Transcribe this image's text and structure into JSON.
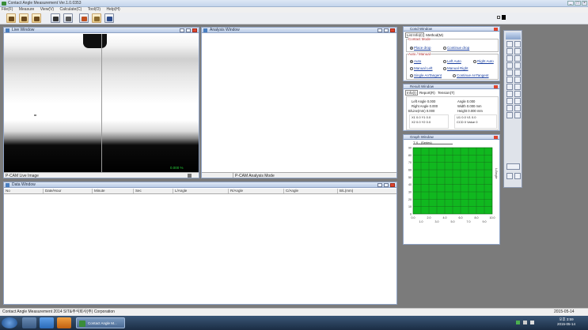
{
  "window": {
    "title": "Contact Angle Measurement Ver.1.0.0353"
  },
  "menu": [
    "File(F)",
    "Measure",
    "View(V)",
    "Calculate(C)",
    "Tool(O)",
    "Help(H)"
  ],
  "toolbar": {
    "buttons": [
      "open-button",
      "save-button",
      "print-button",
      "camera-button",
      "image-button",
      "scissors-button",
      "doc-button",
      "exit-button"
    ]
  },
  "live_window": {
    "title": "Live Window",
    "overlay": "0.000 %",
    "status": "P-CAM Live Image"
  },
  "analysis_window": {
    "title": "Analysis Window",
    "status": "P-CAM Analysis Mode"
  },
  "data_window": {
    "title": "Data Window",
    "columns": [
      "No",
      "Date/Hour",
      "Minute",
      "Sec",
      "L/Angle",
      "R/Angle",
      "C/Angle",
      "B/L(mm)"
    ]
  },
  "cond_window": {
    "title": "Cond Window",
    "tabs": [
      "List Info(I)",
      "Method(M)"
    ],
    "contact_mode_label": "Contact Mode",
    "contact_modes": [
      {
        "label": "Place drop",
        "on": true
      },
      {
        "label": "Continue drop",
        "on": false
      }
    ],
    "auto_manual_label": "Auto / Manual",
    "options": [
      {
        "label": "Auto",
        "on": true
      },
      {
        "label": "Left Auto",
        "on": false
      },
      {
        "label": "Right Auto",
        "on": false
      },
      {
        "label": "Manual Left",
        "on": false
      },
      {
        "label": "Manual Right",
        "on": false
      },
      {
        "label": "Single AnTangent",
        "on": false
      },
      {
        "label": "Continue AnTangent",
        "on": false
      }
    ]
  },
  "result_window": {
    "title": "Result Window",
    "tabs": [
      "Info(I)",
      "Report(R)",
      "Tension(T)"
    ],
    "left": [
      {
        "label": "Left Angle",
        "value": "0.000"
      },
      {
        "label": "Right Angle",
        "value": "0.000"
      },
      {
        "label": "B/Line(mm)",
        "value": "0.000"
      }
    ],
    "right": [
      {
        "label": "Angle",
        "value": "0.000"
      },
      {
        "label": "Width",
        "value": "0.000",
        "unit": "mm"
      },
      {
        "label": "Height",
        "value": "0.000",
        "unit": "mm"
      }
    ],
    "xy": [
      "X1",
      "0.0",
      "Y1",
      "0.0",
      "X2",
      "0.0",
      "Y2",
      "0.0"
    ],
    "misc": [
      {
        "label": "U1",
        "value": "0.0"
      },
      {
        "label": "V1",
        "value": "0.0"
      },
      {
        "label": "CCD",
        "value": "0"
      },
      {
        "label": "Value",
        "value": "0"
      }
    ]
  },
  "graph_window": {
    "title": "Graph Window",
    "tab": "T X - (Series)",
    "side_label": "L/Angle",
    "colors": {
      "plot": "#10b81f",
      "grid": "#1a5f1a"
    }
  },
  "chart_data": {
    "type": "line",
    "series": [],
    "ylim": [
      0,
      90
    ],
    "yticks": [
      "90",
      "80",
      "70",
      "60",
      "50",
      "40",
      "30",
      "20",
      "10",
      "0"
    ],
    "xticks_top": [
      "0.0",
      "2.0",
      "4.0",
      "6.0",
      "8.0",
      "10.0"
    ],
    "xticks_bottom": [
      "1.0",
      "3.0",
      "5.0",
      "7.0",
      "9.0"
    ]
  },
  "statusbar": {
    "left": "Contact Angle Measurement 2014 SIT&주식회사(주) Corporation",
    "right": "2015-05-14"
  },
  "taskbar": {
    "active_app": "Contact Angle M...",
    "clock_time": "오후 3:59",
    "clock_date": "2015-05-14"
  }
}
